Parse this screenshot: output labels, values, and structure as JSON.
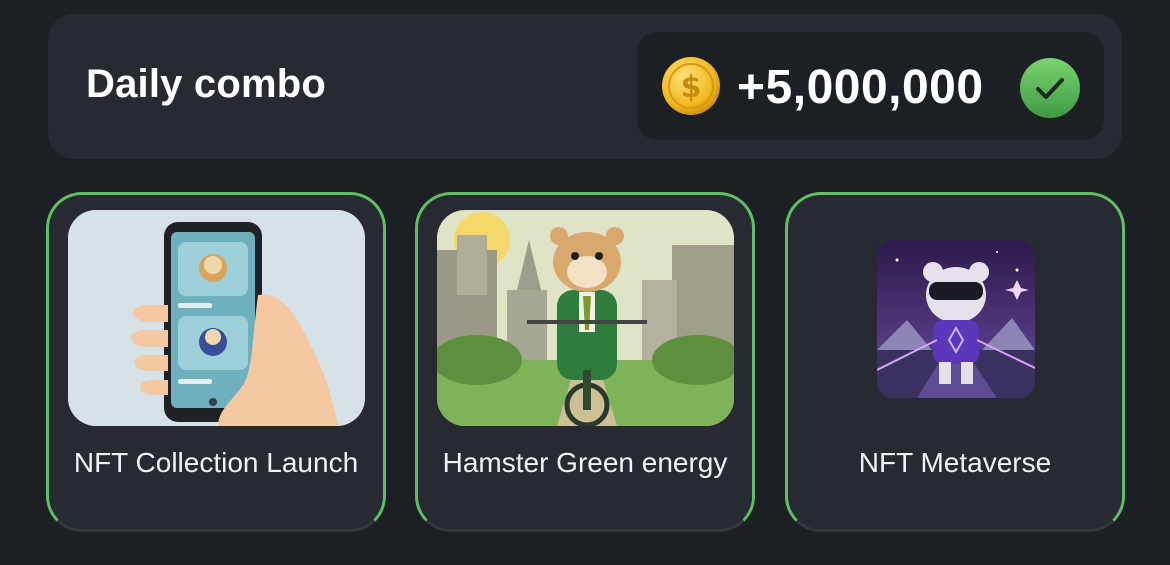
{
  "header": {
    "title": "Daily combo",
    "reward": {
      "icon": "dollar-coin-icon",
      "value": "+5,000,000",
      "status_icon": "check-circle-icon"
    }
  },
  "cards": [
    {
      "label": "NFT Collection Launch",
      "image": "phone-nft-collection-illustration"
    },
    {
      "label": "Hamster Green energy",
      "image": "hamster-on-bicycle-illustration"
    },
    {
      "label": "NFT Metaverse",
      "image": "hamster-vr-metaverse-illustration"
    }
  ],
  "colors": {
    "background": "#1c1f24",
    "panel": "#272a30",
    "accent_green": "#5fbf63",
    "coin_gold": "#f5c12e"
  }
}
